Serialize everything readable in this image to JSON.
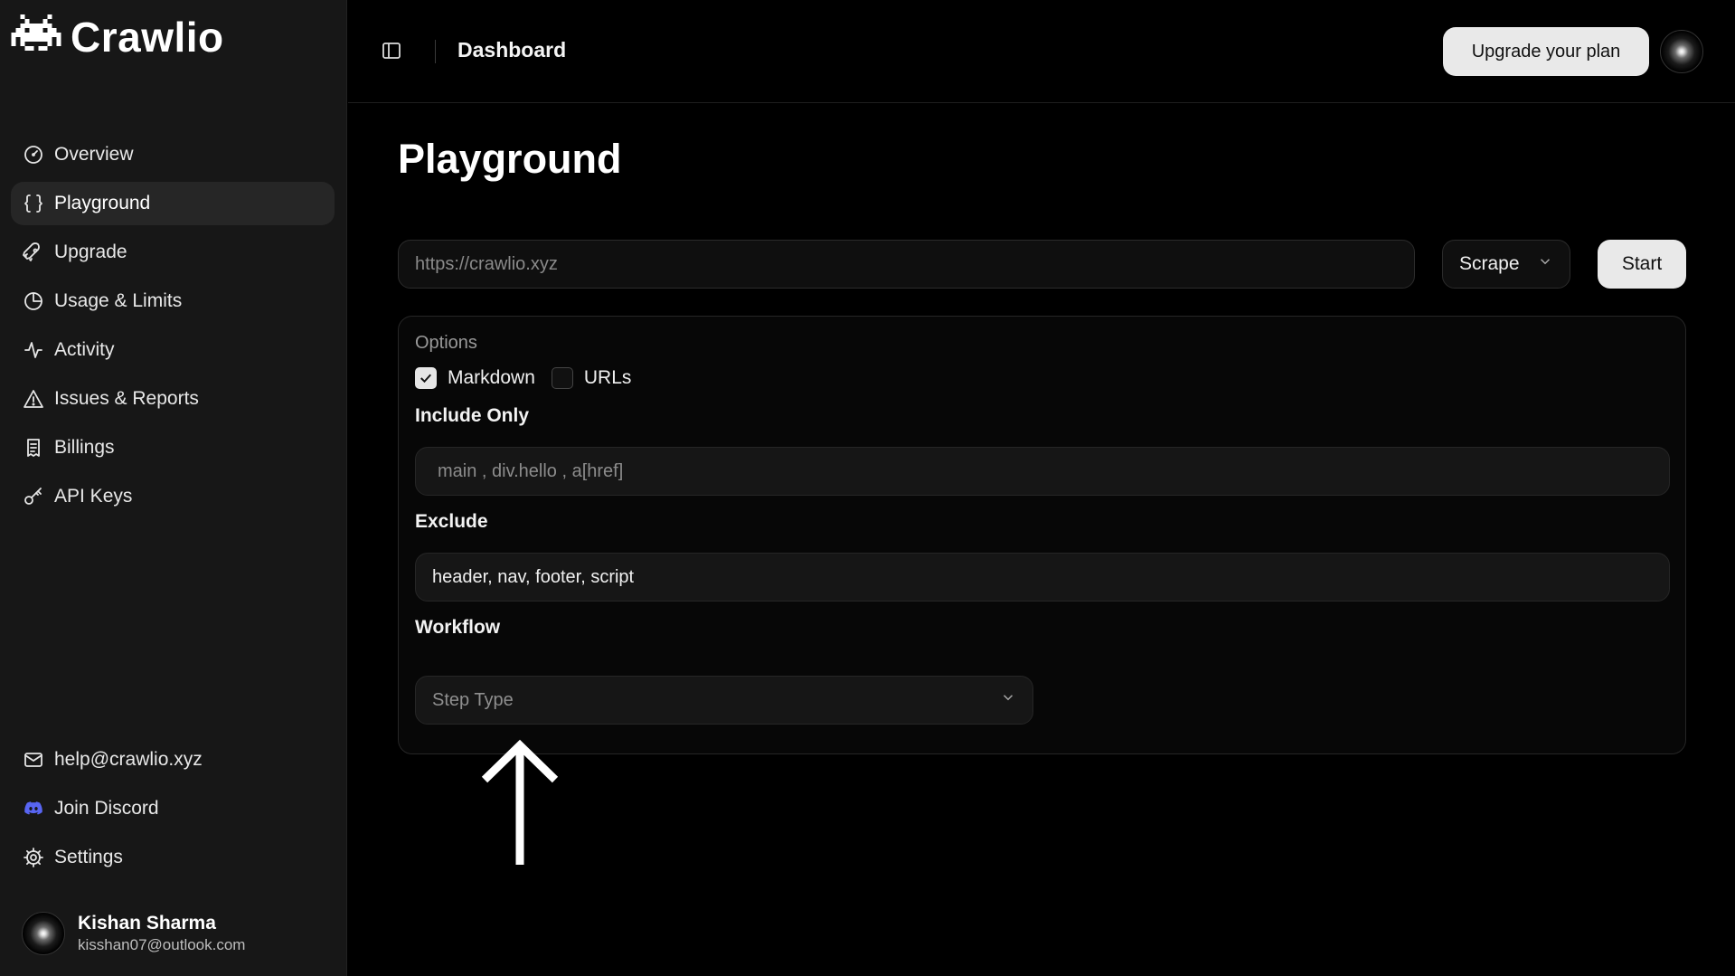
{
  "brand": {
    "name": "Crawlio"
  },
  "nav": {
    "items": [
      {
        "label": "Overview",
        "icon": "gauge-icon"
      },
      {
        "label": "Playground",
        "icon": "braces-icon",
        "active": true
      },
      {
        "label": "Upgrade",
        "icon": "rocket-icon"
      },
      {
        "label": "Usage & Limits",
        "icon": "pie-chart-icon"
      },
      {
        "label": "Activity",
        "icon": "activity-icon"
      },
      {
        "label": "Issues & Reports",
        "icon": "warning-icon"
      },
      {
        "label": "Billings",
        "icon": "receipt-icon"
      },
      {
        "label": "API Keys",
        "icon": "key-icon"
      }
    ],
    "bottom": [
      {
        "label": "help@crawlio.xyz",
        "icon": "mail-icon"
      },
      {
        "label": "Join Discord",
        "icon": "discord-icon"
      },
      {
        "label": "Settings",
        "icon": "gear-icon"
      }
    ]
  },
  "user": {
    "name": "Kishan Sharma",
    "email": "kisshan07@outlook.com"
  },
  "header": {
    "breadcrumb": "Dashboard",
    "upgrade_label": "Upgrade your plan"
  },
  "main": {
    "title": "Playground",
    "url_placeholder": "https://crawlio.xyz",
    "mode": "Scrape",
    "start_label": "Start",
    "options": {
      "heading": "Options",
      "markdown_label": "Markdown",
      "markdown_checked": true,
      "urls_label": "URLs",
      "urls_checked": false,
      "include_label": "Include Only",
      "include_placeholder": "main , div.hello , a[href]",
      "exclude_label": "Exclude",
      "exclude_value": "header, nav, footer, script",
      "workflow_label": "Workflow",
      "step_placeholder": "Step Type"
    }
  },
  "colors": {
    "background": "#000000",
    "sidebar": "#171717",
    "accent_button": "#e9e9e9",
    "discord": "#5865F2"
  }
}
